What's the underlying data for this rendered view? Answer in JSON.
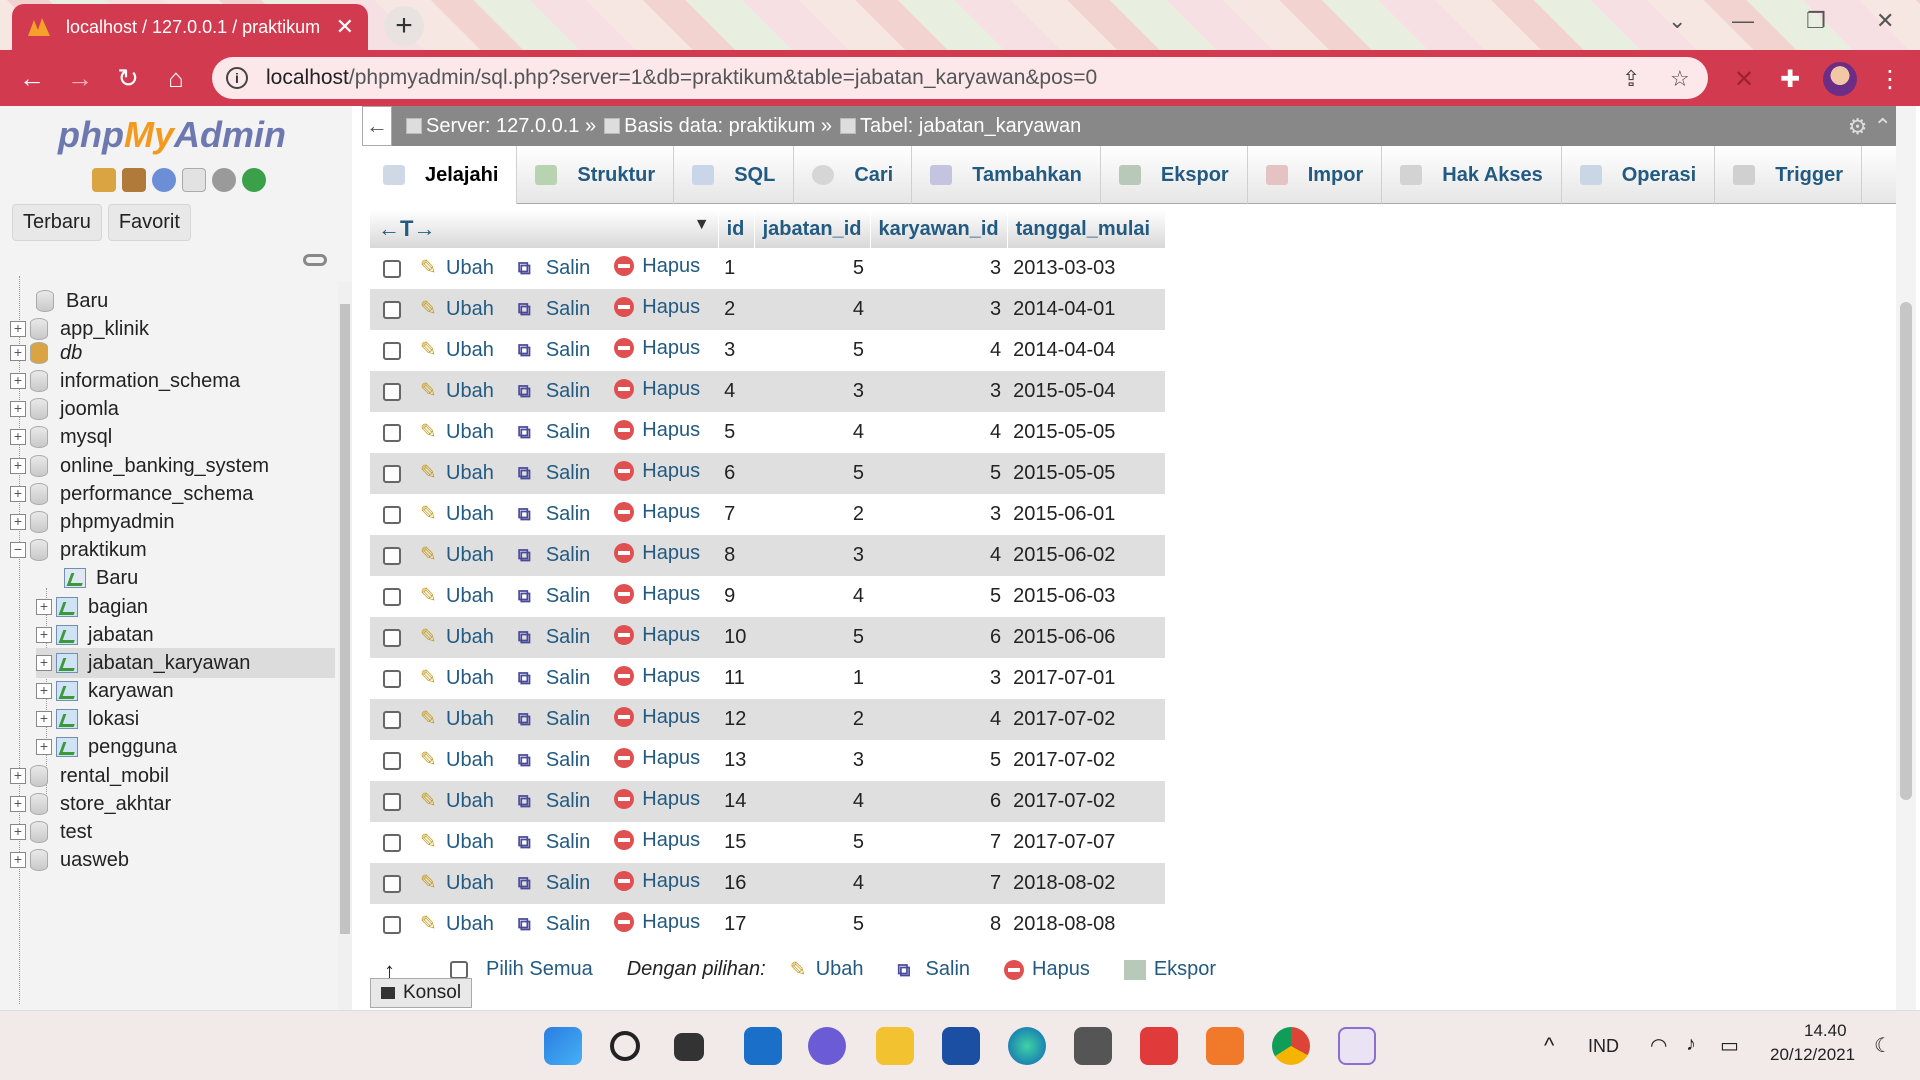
{
  "browser": {
    "tab_title": "localhost / 127.0.0.1 / praktikum",
    "tab_close": "✕",
    "new_tab": "+",
    "url_host": "localhost",
    "url_path": "/phpmyadmin/sql.php?server=1&db=praktikum&table=jabatan_karyawan&pos=0",
    "back": "←",
    "forward": "→",
    "reload": "↻",
    "home": "⌂",
    "share_icon": "⇪",
    "star_icon": "☆",
    "menu_icon": "⋮"
  },
  "left_panel": {
    "logo_php": "php",
    "logo_my": "My",
    "logo_admin": "Admin",
    "tabs": [
      "Terbaru",
      "Favorit"
    ],
    "tree": {
      "new_root": "Baru",
      "dbs_top": [
        "app_klinik",
        "db",
        "information_schema",
        "joomla",
        "mysql",
        "online_banking_system",
        "performance_schema",
        "phpmyadmin"
      ],
      "current_db": "praktikum",
      "new_table": "Baru",
      "tables": [
        "bagian",
        "jabatan",
        "jabatan_karyawan",
        "karyawan",
        "lokasi",
        "pengguna"
      ],
      "dbs_bottom": [
        "rental_mobil",
        "store_akhtar",
        "test",
        "uasweb"
      ]
    }
  },
  "breadcrumb": {
    "server": "Server: 127.0.0.1 »",
    "database": "Basis data: praktikum »",
    "table": "Tabel: jabatan_karyawan"
  },
  "menu_tabs": [
    "Jelajahi",
    "Struktur",
    "SQL",
    "Cari",
    "Tambahkan",
    "Ekspor",
    "Impor",
    "Hak Akses",
    "Operasi",
    "Trigger"
  ],
  "table": {
    "arrows": "←T→",
    "sort_marker": "▼",
    "columns": [
      "id",
      "jabatan_id",
      "karyawan_id",
      "tanggal_mulai"
    ],
    "action_labels": {
      "edit": "Ubah",
      "copy": "Salin",
      "delete": "Hapus"
    },
    "rows": [
      {
        "id": "1",
        "jabatan_id": "5",
        "karyawan_id": "3",
        "tanggal_mulai": "2013-03-03"
      },
      {
        "id": "2",
        "jabatan_id": "4",
        "karyawan_id": "3",
        "tanggal_mulai": "2014-04-01"
      },
      {
        "id": "3",
        "jabatan_id": "5",
        "karyawan_id": "4",
        "tanggal_mulai": "2014-04-04"
      },
      {
        "id": "4",
        "jabatan_id": "3",
        "karyawan_id": "3",
        "tanggal_mulai": "2015-05-04"
      },
      {
        "id": "5",
        "jabatan_id": "4",
        "karyawan_id": "4",
        "tanggal_mulai": "2015-05-05"
      },
      {
        "id": "6",
        "jabatan_id": "5",
        "karyawan_id": "5",
        "tanggal_mulai": "2015-05-05"
      },
      {
        "id": "7",
        "jabatan_id": "2",
        "karyawan_id": "3",
        "tanggal_mulai": "2015-06-01"
      },
      {
        "id": "8",
        "jabatan_id": "3",
        "karyawan_id": "4",
        "tanggal_mulai": "2015-06-02"
      },
      {
        "id": "9",
        "jabatan_id": "4",
        "karyawan_id": "5",
        "tanggal_mulai": "2015-06-03"
      },
      {
        "id": "10",
        "jabatan_id": "5",
        "karyawan_id": "6",
        "tanggal_mulai": "2015-06-06"
      },
      {
        "id": "11",
        "jabatan_id": "1",
        "karyawan_id": "3",
        "tanggal_mulai": "2017-07-01"
      },
      {
        "id": "12",
        "jabatan_id": "2",
        "karyawan_id": "4",
        "tanggal_mulai": "2017-07-02"
      },
      {
        "id": "13",
        "jabatan_id": "3",
        "karyawan_id": "5",
        "tanggal_mulai": "2017-07-02"
      },
      {
        "id": "14",
        "jabatan_id": "4",
        "karyawan_id": "6",
        "tanggal_mulai": "2017-07-02"
      },
      {
        "id": "15",
        "jabatan_id": "5",
        "karyawan_id": "7",
        "tanggal_mulai": "2017-07-07"
      },
      {
        "id": "16",
        "jabatan_id": "4",
        "karyawan_id": "7",
        "tanggal_mulai": "2018-08-02"
      },
      {
        "id": "17",
        "jabatan_id": "5",
        "karyawan_id": "8",
        "tanggal_mulai": "2018-08-08"
      }
    ]
  },
  "bottom": {
    "select_all": "Pilih Semua",
    "with_selected": "Dengan pilihan:",
    "edit": "Ubah",
    "copy": "Salin",
    "delete": "Hapus",
    "export": "Ekspor",
    "console": "Konsol",
    "up_arrow": "↑"
  },
  "taskbar": {
    "language": "IND",
    "time": "14.40",
    "date": "20/12/2021",
    "chevron": "^"
  },
  "colors": {
    "browser_accent": "#d23a4f",
    "pma_link": "#235a81",
    "row_alt": "#dfdfdf"
  }
}
